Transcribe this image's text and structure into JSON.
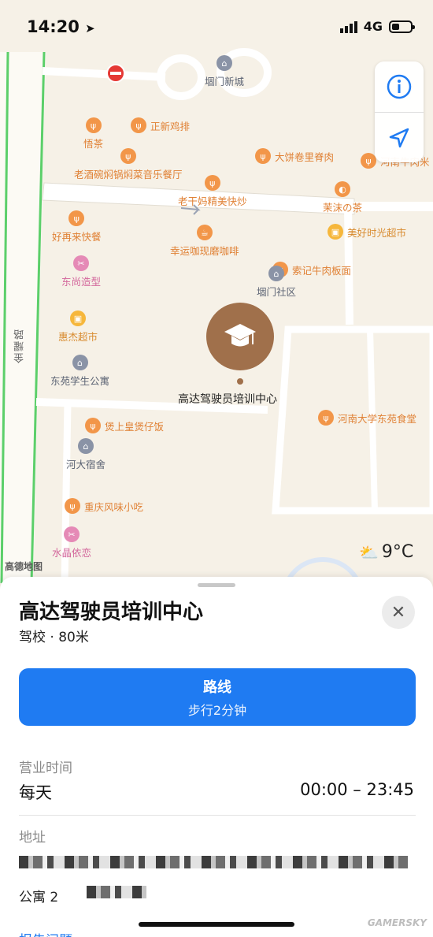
{
  "status_bar": {
    "time": "14:20",
    "network": "4G"
  },
  "map": {
    "street_vertical": "金耀路",
    "attribution": "高德地图",
    "weather_temp": "9°C",
    "pois": [
      {
        "id": "mennewcity",
        "label": "堌门新城",
        "kind": "home"
      },
      {
        "id": "zhengxin",
        "label": "正新鸡排",
        "kind": "food"
      },
      {
        "id": "wucha",
        "label": "悟茶",
        "kind": "food"
      },
      {
        "id": "laojiu",
        "label": "老酒碗焖锅焖菜音乐餐厅",
        "kind": "food"
      },
      {
        "id": "dabing",
        "label": "大饼卷里脊肉",
        "kind": "food"
      },
      {
        "id": "henanniu",
        "label": "河南牛肉米",
        "kind": "food"
      },
      {
        "id": "laoganma",
        "label": "老干妈精美快炒",
        "kind": "food"
      },
      {
        "id": "moli",
        "label": "茉沫の茶",
        "kind": "food"
      },
      {
        "id": "haozai",
        "label": "好再来快餐",
        "kind": "food"
      },
      {
        "id": "xingyun",
        "label": "幸运咖现磨咖啡",
        "kind": "food"
      },
      {
        "id": "meihao",
        "label": "美好时光超市",
        "kind": "shop"
      },
      {
        "id": "dongshang",
        "label": "东尚造型",
        "kind": "beauty"
      },
      {
        "id": "suoji",
        "label": "索记牛肉板面",
        "kind": "food"
      },
      {
        "id": "mencomm",
        "label": "堌门社区",
        "kind": "home"
      },
      {
        "id": "huijie",
        "label": "惠杰超市",
        "kind": "shop"
      },
      {
        "id": "dongyuan",
        "label": "东苑学生公寓",
        "kind": "home"
      },
      {
        "id": "henandong",
        "label": "河南大学东苑食堂",
        "kind": "food"
      },
      {
        "id": "bao",
        "label": "煲上皇煲仔饭",
        "kind": "food"
      },
      {
        "id": "heda",
        "label": "河大宿舍",
        "kind": "home"
      },
      {
        "id": "chongqing",
        "label": "重庆风味小吃",
        "kind": "food"
      },
      {
        "id": "shuijing",
        "label": "水晶依恋",
        "kind": "beauty"
      }
    ],
    "selected_pin_label": "高达驾驶员培训中心"
  },
  "sheet": {
    "title": "高达驾驶员培训中心",
    "subtitle": "驾校 · 80米",
    "route_title": "路线",
    "route_sub": "步行2分钟",
    "hours_label": "营业时间",
    "hours_day": "每天",
    "hours_time": "00:00 – 23:45",
    "address_label": "地址",
    "address_line2": "公寓 2",
    "report_label": "报告问题",
    "watermark": "GAMERSKY"
  }
}
